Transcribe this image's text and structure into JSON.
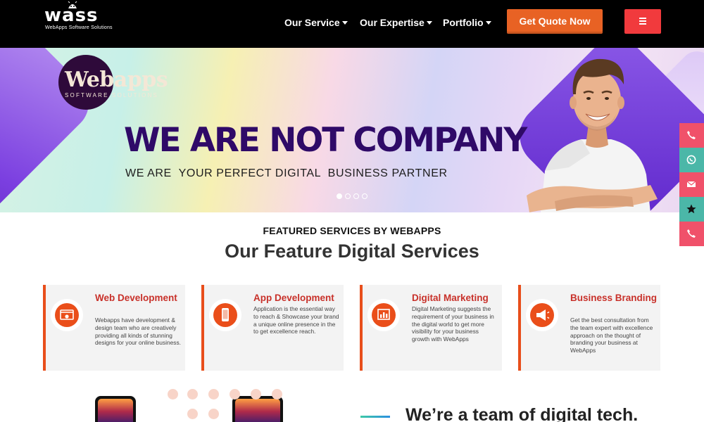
{
  "header": {
    "logo_text": "wass",
    "logo_tagline": "WebApps Software Solutions",
    "nav": [
      {
        "label": "Our Service"
      },
      {
        "label": "Our Expertise"
      },
      {
        "label": "Portfolio"
      }
    ],
    "cta_label": "Get Quote Now",
    "menu_icon": "hamburger-icon"
  },
  "hero": {
    "badge_title": "Webapps",
    "badge_subtitle": "SOFTWARE SOLUTIONS",
    "headline": "WE ARE NOT COMPANY",
    "subline": "WE ARE  YOUR PERFECT DIGITAL  BUSINESS PARTNER",
    "slides_total": 4,
    "active_slide": 1
  },
  "side_actions": [
    {
      "icon": "phone-icon",
      "color": "#f0516a"
    },
    {
      "icon": "whatsapp-icon",
      "color": "#4bb7a8"
    },
    {
      "icon": "mail-icon",
      "color": "#f0516a"
    },
    {
      "icon": "star-icon",
      "color": "#4bb7a8"
    },
    {
      "icon": "phone-icon",
      "color": "#f0516a"
    }
  ],
  "services": {
    "kicker": "FEATURED SERVICES BY WEBAPPS",
    "title": "Our Feature Digital Services",
    "cards": [
      {
        "title": "Web Development",
        "icon": "web-development-icon",
        "text": "Webapps have development & design team who are creatively providing all kinds of stunning designs for your online business."
      },
      {
        "title": "App Development",
        "icon": "mobile-app-icon",
        "text": "Application is the essential way to reach & Showcase your brand a unique online presence in the to get excellence reach."
      },
      {
        "title": "Digital Marketing",
        "icon": "marketing-chart-icon",
        "text": "Digital Marketing suggests the requirement of your business in the digital world to get more visibility for your business growth with WebApps"
      },
      {
        "title": "Business Branding",
        "icon": "megaphone-icon",
        "text": "Get the best consultation from the team expert with excellence approach on the thought of branding your business at WebApps"
      }
    ]
  },
  "about": {
    "heading": "We’re a team of digital tech."
  },
  "colors": {
    "accent": "#e86224",
    "menu": "#f13a3d",
    "card_title": "#c8312a",
    "hero_headline": "#2f0a68"
  }
}
